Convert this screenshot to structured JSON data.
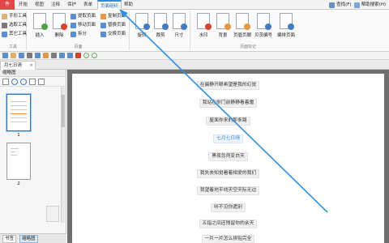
{
  "ribbon_tabs": {
    "file": "件",
    "items": [
      "开始",
      "视图",
      "注释",
      "保护",
      "表单",
      "页面组织",
      "帮助"
    ],
    "active_index": 5
  },
  "top_right": {
    "find": "查找(F)",
    "help_search": "帮助搜索(H)"
  },
  "tools_group": {
    "items": [
      "手形工具",
      "选取工具",
      "其它工具"
    ],
    "label": "工具"
  },
  "pages_group": {
    "large": [
      "插入",
      "删除"
    ],
    "small": [
      "提取页面",
      "移动页面",
      "拆分"
    ],
    "small2": [
      "复制页面",
      "替换页面",
      "交换页面"
    ],
    "label": "页面"
  },
  "transform_group": {
    "large": [
      "旋转",
      "裁剪",
      "尺寸"
    ]
  },
  "mark_group": {
    "large": [
      "水印",
      "背景",
      "页眉页脚",
      "贝茨编号",
      "编排页面"
    ],
    "label": "页面标记"
  },
  "doc_tab": {
    "title": "月七日清",
    "close": "×"
  },
  "sidebar": {
    "title": "缩略图",
    "pages": [
      "1",
      "2"
    ]
  },
  "bottom_tabs": [
    "书签",
    "缩略图"
  ],
  "poem": {
    "lines": [
      "在晨静开眼希望是我的幻觉",
      "我站在你门前静静看着雷",
      "屋面你来的那条路",
      "七月七日晴",
      "黑夜忽然变白天",
      "我失去知觉看着相爱的我们",
      "我望着地平线天空天际无边",
      "听不见你遗别",
      "五指之间还残留你的余天",
      "一片一片怎么拼贴完全"
    ],
    "title_index": 3
  },
  "colors": {
    "accent": "#2e8bd8",
    "file_tab": "#e34848",
    "arrow": "#2f8fe0"
  }
}
